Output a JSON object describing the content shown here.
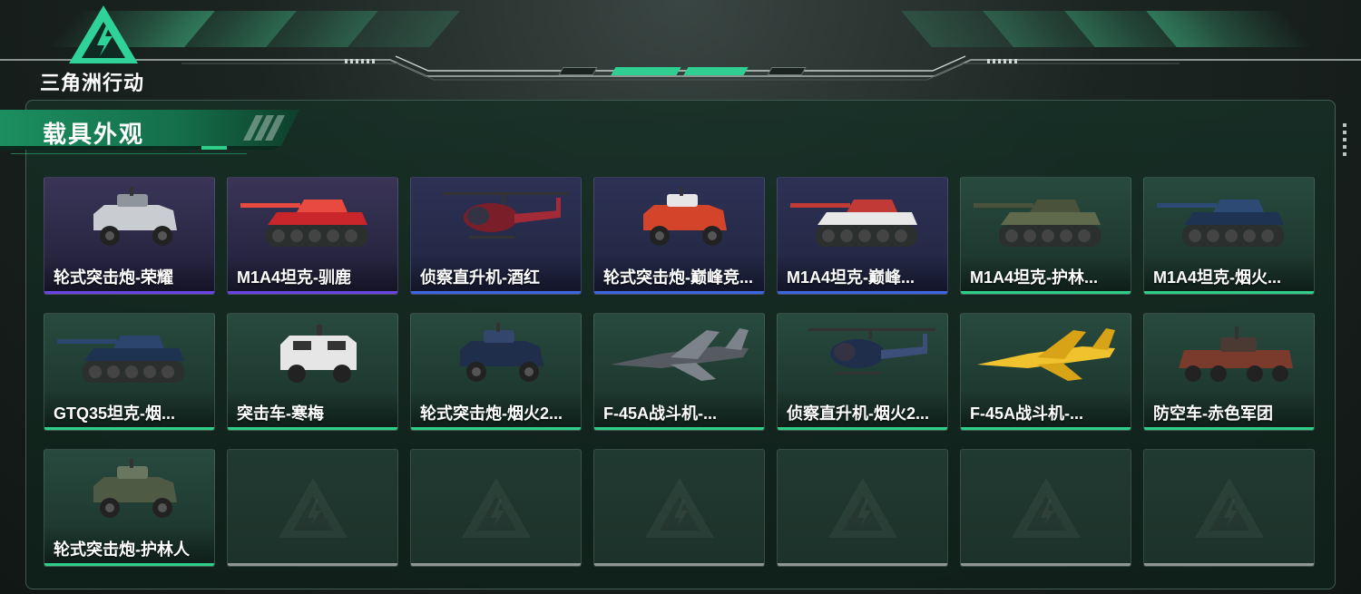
{
  "app": {
    "logo_text": "三角洲行动"
  },
  "pager": {
    "current": 2,
    "total": 4
  },
  "section": {
    "title": "载具外观"
  },
  "vehicles": [
    {
      "name": "轮式突击炮-荣耀",
      "rarity": "purple",
      "icon": "wheeled-assault-gun-icon"
    },
    {
      "name": "M1A4坦克-驯鹿",
      "rarity": "purple",
      "icon": "tank-icon"
    },
    {
      "name": "侦察直升机-酒红",
      "rarity": "blue",
      "icon": "helicopter-icon"
    },
    {
      "name": "轮式突击炮-巅峰竞...",
      "rarity": "blue",
      "icon": "wheeled-assault-gun-icon"
    },
    {
      "name": "M1A4坦克-巅峰...",
      "rarity": "blue",
      "icon": "tank-icon"
    },
    {
      "name": "M1A4坦克-护林...",
      "rarity": "green",
      "icon": "tank-icon"
    },
    {
      "name": "M1A4坦克-烟火...",
      "rarity": "green",
      "icon": "tank-icon"
    },
    {
      "name": "GTQ35坦克-烟...",
      "rarity": "green",
      "icon": "tank-icon"
    },
    {
      "name": "突击车-寒梅",
      "rarity": "green",
      "icon": "assault-vehicle-icon"
    },
    {
      "name": "轮式突击炮-烟火2...",
      "rarity": "green",
      "icon": "wheeled-assault-gun-icon"
    },
    {
      "name": "F-45A战斗机-...",
      "rarity": "green",
      "icon": "fighter-jet-icon"
    },
    {
      "name": "侦察直升机-烟火2...",
      "rarity": "green",
      "icon": "helicopter-icon"
    },
    {
      "name": "F-45A战斗机-...",
      "rarity": "green",
      "icon": "fighter-jet-icon"
    },
    {
      "name": "防空车-赤色军团",
      "rarity": "green",
      "icon": "anti-air-vehicle-icon"
    },
    {
      "name": "轮式突击炮-护林人",
      "rarity": "green",
      "icon": "wheeled-assault-gun-icon"
    }
  ],
  "empty_slots": 6,
  "colors": {
    "accent": "#2fcf8a",
    "rarity_purple": "#6a45e6",
    "rarity_blue": "#3e66e0",
    "rarity_green": "#2fcf8a",
    "empty_bar": "#8e9794"
  }
}
